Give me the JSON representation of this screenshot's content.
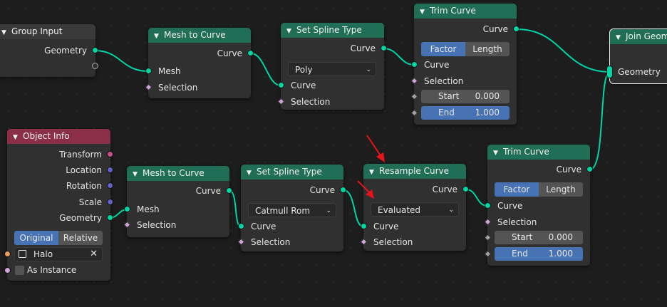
{
  "nodes": {
    "group_input": {
      "title": "Group Input",
      "out_geometry": "Geometry"
    },
    "mesh_to_curve_1": {
      "title": "Mesh to Curve",
      "out_curve": "Curve",
      "in_mesh": "Mesh",
      "in_selection": "Selection"
    },
    "set_spline_type_1": {
      "title": "Set Spline Type",
      "out_curve": "Curve",
      "type_value": "Poly",
      "in_curve": "Curve",
      "in_selection": "Selection"
    },
    "trim_curve_1": {
      "title": "Trim Curve",
      "out_curve": "Curve",
      "mode_factor": "Factor",
      "mode_length": "Length",
      "in_curve": "Curve",
      "in_selection": "Selection",
      "start_label": "Start",
      "start_value": "0.000",
      "end_label": "End",
      "end_value": "1.000"
    },
    "join_geometry": {
      "title": "Join Geom",
      "in_geometry": "Geometry"
    },
    "object_info": {
      "title": "Object Info",
      "out_transform": "Transform",
      "out_location": "Location",
      "out_rotation": "Rotation",
      "out_scale": "Scale",
      "out_geometry": "Geometry",
      "mode_original": "Original",
      "mode_relative": "Relative",
      "object_value": "Halo",
      "as_instance": "As Instance"
    },
    "mesh_to_curve_2": {
      "title": "Mesh to Curve",
      "out_curve": "Curve",
      "in_mesh": "Mesh",
      "in_selection": "Selection"
    },
    "set_spline_type_2": {
      "title": "Set Spline Type",
      "out_curve": "Curve",
      "type_value": "Catmull Rom",
      "in_curve": "Curve",
      "in_selection": "Selection"
    },
    "resample_curve": {
      "title": "Resample Curve",
      "out_curve": "Curve",
      "mode_value": "Evaluated",
      "in_curve": "Curve",
      "in_selection": "Selection"
    },
    "trim_curve_2": {
      "title": "Trim Curve",
      "out_curve": "Curve",
      "mode_factor": "Factor",
      "mode_length": "Length",
      "in_curve": "Curve",
      "in_selection": "Selection",
      "start_label": "Start",
      "start_value": "0.000",
      "end_label": "End",
      "end_value": "1.000"
    }
  },
  "colors": {
    "geometry_socket": "#00d6a3",
    "header_geometry": "#1f6e55",
    "header_object": "#8b2e48",
    "accent_blue": "#4772b3",
    "annotation_arrow": "#e8141a"
  },
  "icons": {
    "collapse": "chevron-down-icon",
    "dropdown": "caret-down-icon",
    "object": "object-icon",
    "clear": "close-icon"
  }
}
